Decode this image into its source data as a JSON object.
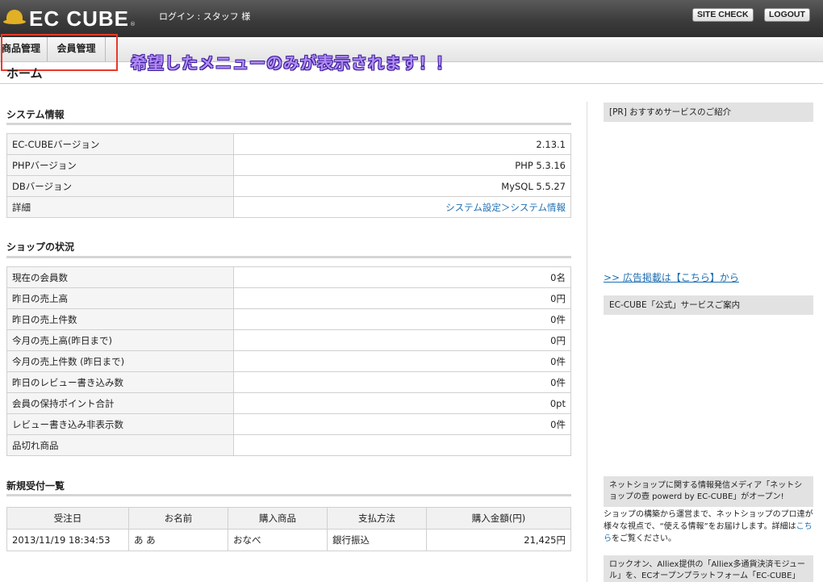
{
  "header": {
    "logo_text": "EC CUBE",
    "login_info": "ログイン : スタッフ 様",
    "site_check": "SITE CHECK",
    "logout": "LOGOUT"
  },
  "nav": {
    "items": [
      {
        "label": "商品管理"
      },
      {
        "label": "会員管理"
      }
    ]
  },
  "annotation": "希望したメニューのみが表示されます！！",
  "page_title": "ホーム",
  "system_info": {
    "title": "システム情報",
    "rows": [
      {
        "label": "EC-CUBEバージョン",
        "value": "2.13.1"
      },
      {
        "label": "PHPバージョン",
        "value": "PHP 5.3.16"
      },
      {
        "label": "DBバージョン",
        "value": "MySQL 5.5.27"
      },
      {
        "label": "詳細",
        "value": "システム設定＞システム情報"
      }
    ]
  },
  "shop_status": {
    "title": "ショップの状況",
    "rows": [
      {
        "label": "現在の会員数",
        "value": "0名"
      },
      {
        "label": "昨日の売上高",
        "value": "0円"
      },
      {
        "label": "昨日の売上件数",
        "value": "0件"
      },
      {
        "label": "今月の売上高(昨日まで)",
        "value": "0円"
      },
      {
        "label": "今月の売上件数 (昨日まで)",
        "value": "0件"
      },
      {
        "label": "昨日のレビュー書き込み数",
        "value": "0件"
      },
      {
        "label": "会員の保持ポイント合計",
        "value": "0pt"
      },
      {
        "label": "レビュー書き込み非表示数",
        "value": "0件"
      },
      {
        "label": "品切れ商品",
        "value": ""
      }
    ]
  },
  "new_orders": {
    "title": "新規受付一覧",
    "headers": [
      "受注日",
      "お名前",
      "購入商品",
      "支払方法",
      "購入金額(円)"
    ],
    "rows": [
      {
        "date": "2013/11/19 18:34:53",
        "name": "あ あ",
        "product": "おなべ",
        "payment": "銀行振込",
        "amount": "21,425円"
      }
    ]
  },
  "sidebar": {
    "pr_title": "[PR] おすすめサービスのご紹介",
    "ad_link": ">> 広告掲載は【こちら】から",
    "official_title": "EC-CUBE「公式」サービスご案内",
    "media_title": "ネットショップに関する情報発信メディア「ネットショップの壺 powerd by EC-CUBE」がオープン!",
    "media_text_1": "ショップの構築から運営まで、ネットショップのプロ達が様々な視点で、“使える情報”をお届けします。詳細は",
    "media_link": "こちら",
    "media_text_2": "をご覧ください。",
    "alliex_text": "ロックオン、Alliex提供の「Alliex多通貨決済モジュール」を、ECオープンプラットフォーム「EC-CUBE」に標"
  }
}
